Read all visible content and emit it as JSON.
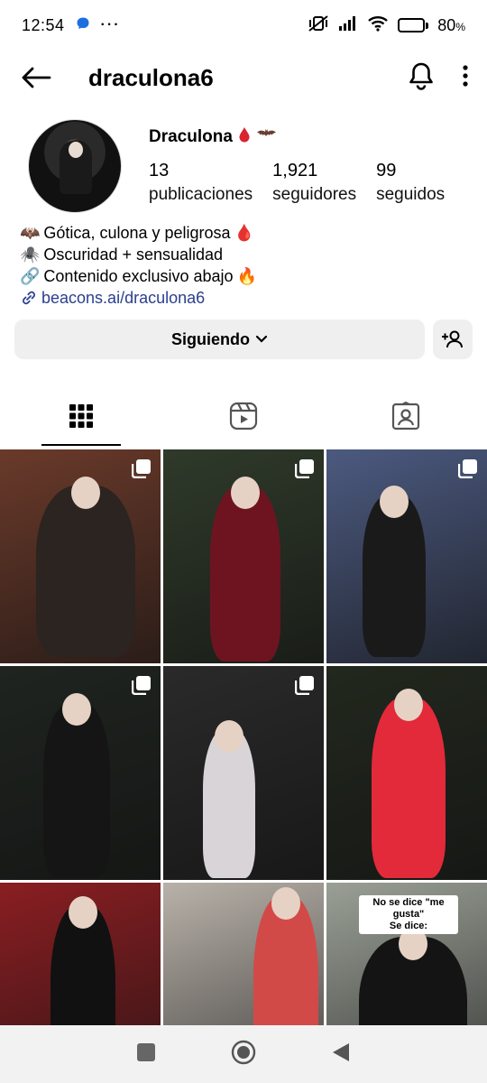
{
  "status_bar": {
    "time": "12:54",
    "battery_text": "80",
    "battery_unit": "%",
    "battery_level": 0.8,
    "more_glyph": "···"
  },
  "header": {
    "username": "draculona6"
  },
  "profile": {
    "display_name": "Draculona",
    "stats": [
      {
        "value": "13",
        "label": "publicaciones"
      },
      {
        "value": "1,921",
        "label": "seguidores"
      },
      {
        "value": "99",
        "label": "seguidos"
      }
    ],
    "bio": [
      {
        "emoji": "🦇",
        "text": "Gótica, culona y peligrosa",
        "suffix": "🩸"
      },
      {
        "emoji": "🕷️",
        "text": "Oscuridad + sensualidad",
        "suffix": ""
      },
      {
        "emoji": "🔗",
        "text": "Contenido exclusivo abajo",
        "suffix": "🔥"
      }
    ],
    "link": "beacons.ai/draculona6"
  },
  "actions": {
    "following_label": "Siguiendo"
  },
  "tabs": [
    {
      "icon": "grid-icon",
      "active": true
    },
    {
      "icon": "reels-icon",
      "active": false
    },
    {
      "icon": "tagged-icon",
      "active": false
    }
  ],
  "grid": [
    {
      "bg": "#6a3a2a",
      "accent": "#2b2420",
      "multi": true
    },
    {
      "bg": "#2f3a2a",
      "accent": "#6e1420",
      "multi": true
    },
    {
      "bg": "#4c5a80",
      "accent": "#1a1a1a",
      "multi": true
    },
    {
      "bg": "#1f2420",
      "accent": "#151515",
      "multi": true
    },
    {
      "bg": "#2a2a2a",
      "accent": "#d8d4d8",
      "multi": true
    },
    {
      "bg": "#22281e",
      "accent": "#e22a3a",
      "multi": false
    },
    {
      "bg": "#8a1e22",
      "accent": "#111111",
      "multi": false
    },
    {
      "bg": "#b9b2aa",
      "accent": "#d24a48",
      "multi": false
    },
    {
      "bg": "#9aa096",
      "accent": "#141414",
      "multi": false,
      "overlay_line1": "No se dice \"me gusta\"",
      "overlay_line2": "Se dice:"
    }
  ]
}
